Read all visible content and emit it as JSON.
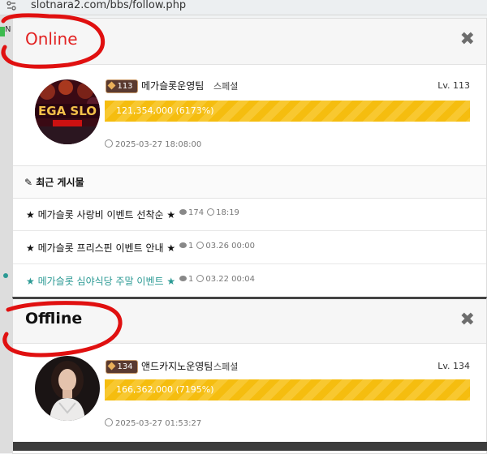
{
  "browser": {
    "url": "slotnara2.com/bbs/follow.php"
  },
  "sidebar_edge": {
    "letter": "N"
  },
  "online_card": {
    "status": "Online",
    "user": {
      "badge_level": "113",
      "name": "메가슬롯운영팀",
      "grade": "스페셜",
      "level": "Lv. 113",
      "exp": "121,354,000 (6173%)",
      "joined": "2025-03-27 18:08:00",
      "avatar_text": "EGA SLO"
    },
    "posts_title": "최근 게시물",
    "posts": [
      {
        "title": "★ 메가슬롯 사랑비 이벤트 선착순 ★",
        "comments": "174",
        "time": "18:19"
      },
      {
        "title": "★ 메가슬롯 프리스핀 이벤트 안내 ★",
        "comments": "1",
        "time": "03.26 00:00"
      },
      {
        "title": "★ 메가슬롯 심야식당 주말 이벤트 ★",
        "comments": "1",
        "time": "03.22 00:04"
      }
    ]
  },
  "offline_card": {
    "status": "Offline",
    "user": {
      "badge_level": "134",
      "name": "앤드카지노운영팀",
      "grade": "스페셜",
      "level": "Lv. 134",
      "exp": "166,362,000 (7195%)",
      "joined": "2025-03-27 01:53:27"
    }
  },
  "colors": {
    "online_red": "#e22222",
    "exp_yellow": "#f5bd0f",
    "active_post": "#2b9a94",
    "annotation_red": "#e01010"
  },
  "icons": [
    "settings-icon",
    "close-icon",
    "level-icon",
    "clock-icon",
    "comment-icon",
    "pencil-icon"
  ]
}
